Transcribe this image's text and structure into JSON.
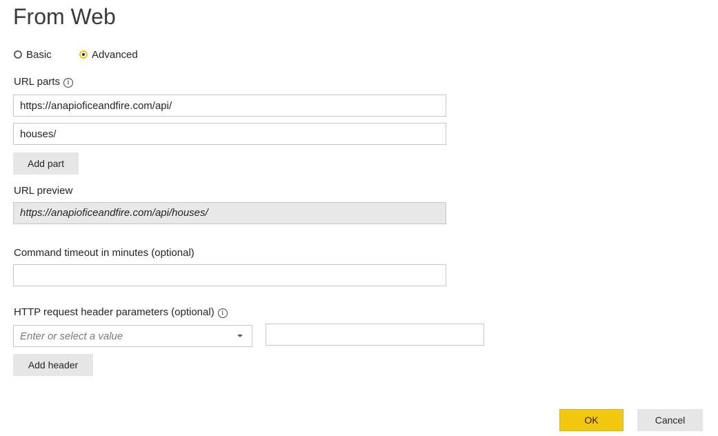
{
  "dialog": {
    "title": "From Web",
    "mode_basic": "Basic",
    "mode_advanced": "Advanced",
    "selected_mode": "Advanced"
  },
  "url_parts": {
    "label": "URL parts",
    "info_glyph": "i",
    "parts": [
      "https://anapioficeandfire.com/api/",
      "houses/"
    ],
    "add_part_label": "Add part"
  },
  "url_preview": {
    "label": "URL preview",
    "value": "https://anapioficeandfire.com/api/houses/"
  },
  "timeout": {
    "label": "Command timeout in minutes (optional)",
    "value": ""
  },
  "headers": {
    "label": "HTTP request header parameters (optional)",
    "info_glyph": "i",
    "key_placeholder": "Enter or select a value",
    "value": "",
    "add_header_label": "Add header"
  },
  "footer": {
    "ok_label": "OK",
    "cancel_label": "Cancel"
  },
  "colors": {
    "accent": "#f2c811",
    "button_bg": "#e6e6e6",
    "preview_bg": "#e8e8e8",
    "border": "#c8c6c4"
  }
}
